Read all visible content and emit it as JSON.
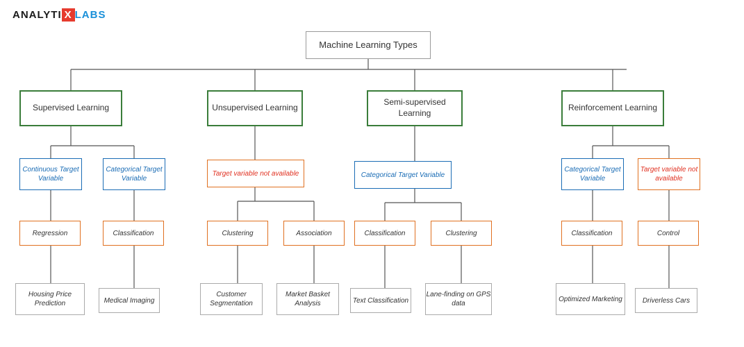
{
  "logo": {
    "analytix": "ANALYTI",
    "x": "X",
    "labs": "LABS"
  },
  "nodes": {
    "root": "Machine Learning Types",
    "supervised": "Supervised Learning",
    "unsupervised": "Unsupervised Learning",
    "semi": "Semi-supervised Learning",
    "reinforcement": "Reinforcement Learning",
    "continuous": "Continuous Target Variable",
    "categorical_sup": "Categorical Target Variable",
    "target_not_avail_unsup": "Target variable not available",
    "cat_target_semi": "Categorical Target Variable",
    "cat_target_reinf": "Categorical Target Variable",
    "target_not_avail_reinf": "Target variable not available",
    "regression": "Regression",
    "classification_sup": "Classification",
    "clustering_unsup": "Clustering",
    "association": "Association",
    "classification_semi": "Classification",
    "clustering_semi": "Clustering",
    "classification_reinf": "Classification",
    "control": "Control",
    "housing": "Housing Price Prediction",
    "medical": "Medical Imaging",
    "customer_seg": "Customer Segmentation",
    "market_basket": "Market Basket Analysis",
    "text_class": "Text Classification",
    "lane_finding": "Lane-finding on GPS data",
    "optimized": "Optimized Marketing",
    "driverless": "Driverless Cars"
  }
}
